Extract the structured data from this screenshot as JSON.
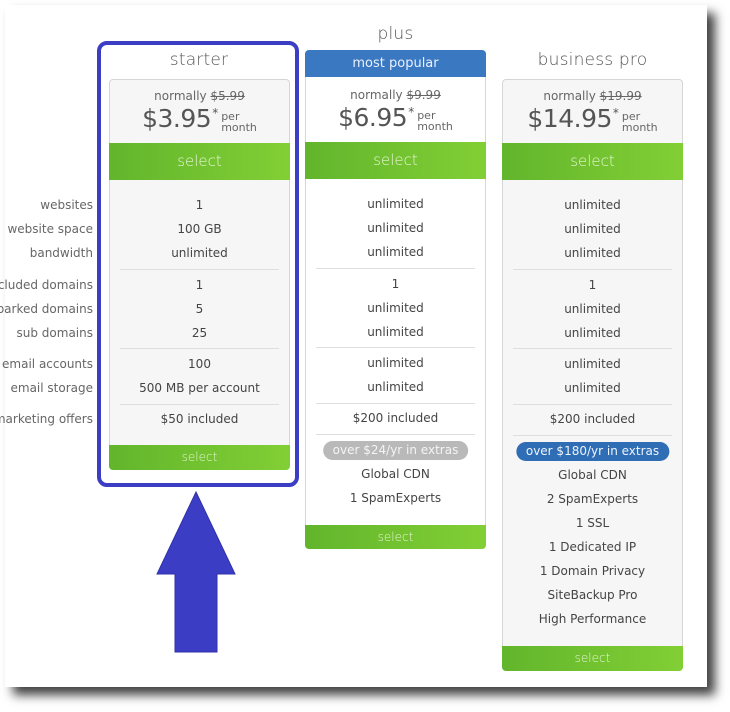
{
  "feature_labels": [
    "websites",
    "website space",
    "bandwidth",
    "included domains",
    "parked domains",
    "sub domains",
    "email accounts",
    "email storage",
    "marketing offers"
  ],
  "plans": [
    {
      "name": "starter",
      "normally_label": "normally",
      "old_price": "$5.99",
      "price": "$3.95",
      "asterisk": "*",
      "per": "per",
      "month": "month",
      "select_label": "select",
      "features": [
        "1",
        "100 GB",
        "unlimited",
        "1",
        "5",
        "25",
        "100",
        "500 MB per account",
        "$50 included"
      ],
      "extras_badge": null,
      "extras": [],
      "highlighted": true
    },
    {
      "name": "plus",
      "badge": "most popular",
      "normally_label": "normally",
      "old_price": "$9.99",
      "price": "$6.95",
      "asterisk": "*",
      "per": "per",
      "month": "month",
      "select_label": "select",
      "features": [
        "unlimited",
        "unlimited",
        "unlimited",
        "1",
        "unlimited",
        "unlimited",
        "unlimited",
        "unlimited",
        "$200 included"
      ],
      "extras_badge": "over $24/yr in extras",
      "extras": [
        "Global CDN",
        "1 SpamExperts"
      ]
    },
    {
      "name": "business pro",
      "normally_label": "normally",
      "old_price": "$19.99",
      "price": "$14.95",
      "asterisk": "*",
      "per": "per",
      "month": "month",
      "select_label": "select",
      "features": [
        "unlimited",
        "unlimited",
        "unlimited",
        "1",
        "unlimited",
        "unlimited",
        "unlimited",
        "unlimited",
        "$200 included"
      ],
      "extras_badge": "over $180/yr in extras",
      "extras": [
        "Global CDN",
        "2 SpamExperts",
        "1 SSL",
        "1 Dedicated IP",
        "1 Domain Privacy",
        "SiteBackup Pro",
        "High Performance"
      ]
    }
  ],
  "colors": {
    "select_green": "#6cc030",
    "popular_blue": "#3a78c2",
    "highlight_blue": "#3b3dc4",
    "extras_badge_grey": "#b9b9b9",
    "extras_badge_blue": "#2f6db5"
  },
  "annotation": {
    "arrow_icon": "up-arrow-icon",
    "highlight": "starter plan highlighted"
  }
}
